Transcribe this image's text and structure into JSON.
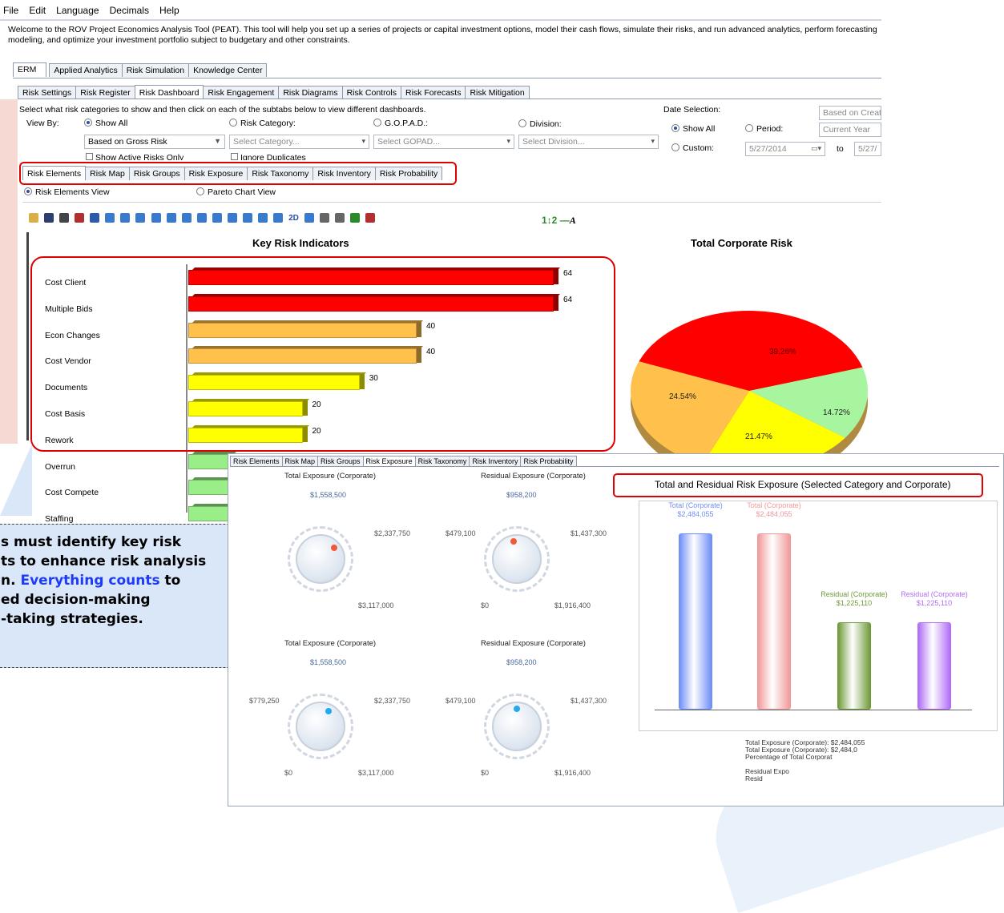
{
  "menu": [
    "File",
    "Edit",
    "Language",
    "Decimals",
    "Help"
  ],
  "welcome_text": "Welcome to the ROV Project Economics Analysis Tool (PEAT). This tool will help you set up a series of projects or capital investment options, model their cash flows, simulate their risks, and run advanced analytics, perform forecasting modeling, and optimize your investment portfolio subject to budgetary and other constraints.",
  "main_tabs": [
    "ERM",
    "Applied Analytics",
    "Risk Simulation",
    "Knowledge Center"
  ],
  "sub_tabs": [
    "Risk Settings",
    "Risk Register",
    "Risk Dashboard",
    "Risk Engagement",
    "Risk Diagrams",
    "Risk Controls",
    "Risk Forecasts",
    "Risk Mitigation"
  ],
  "filters": {
    "instruction": "Select what risk categories to show and then click on each of the subtabs below to view different dashboards.",
    "view_by_label": "View By:",
    "show_all": "Show All",
    "risk_category": "Risk Category:",
    "gopad": "G.O.P.A.D.:",
    "division": "Division:",
    "gross_risk": "Based on Gross Risk",
    "category_placeholder": "Select Category...",
    "gopad_placeholder": "Select GOPAD...",
    "division_placeholder": "Select Division...",
    "active_risks_only": "Show Active Risks Only",
    "ignore_duplicates": "Ignore Duplicates"
  },
  "date_selection": {
    "label": "Date Selection:",
    "show_all": "Show All",
    "period": "Period:",
    "custom": "Custom:",
    "based_on": "Based on Creat",
    "current_year": "Current Year",
    "from": "5/27/2014",
    "to_label": "to",
    "to": "5/27/"
  },
  "dashboard_tabs": [
    "Risk Elements",
    "Risk Map",
    "Risk Groups",
    "Risk Exposure",
    "Risk Taxonomy",
    "Risk Inventory",
    "Risk Probability"
  ],
  "view_options": [
    "Risk Elements View",
    "Pareto Chart View"
  ],
  "chart_data": [
    {
      "type": "bar",
      "title": "Key Risk Indicators",
      "categories": [
        "Cost Client",
        "Multiple Bids",
        "Econ Changes",
        "Cost Vendor",
        "Documents",
        "Cost Basis",
        "Rework",
        "Overrun",
        "Cost Compete",
        "Staffing"
      ],
      "values": [
        64,
        64,
        40,
        40,
        30,
        20,
        20,
        null,
        null,
        null
      ],
      "colors": [
        "#ff0000",
        "#ff0000",
        "#ffc04c",
        "#ffc04c",
        "#ffff00",
        "#ffff00",
        "#ffff00",
        "#99ee88",
        "#99ee88",
        "#99ee88"
      ],
      "xlim": [
        0,
        70
      ]
    },
    {
      "type": "pie",
      "title": "Total Corporate Risk",
      "labels": [
        "39.26%",
        "14.72%",
        "21.47%",
        "24.54%"
      ],
      "values": [
        39.26,
        14.72,
        21.47,
        24.54
      ],
      "colors": [
        "#ff0000",
        "#a8f5a0",
        "#ffff00",
        "#ffc04c"
      ]
    },
    {
      "type": "bar",
      "title": "Total and Residual Risk Exposure (Selected Category and Corporate)",
      "categories": [
        "Total (Corporate)",
        "Total (Corporate)",
        "Residual (Corporate)",
        "Residual (Corporate)"
      ],
      "value_labels": [
        "$2,484,055",
        "$2,484,055",
        "$1,225,110",
        "$1,225,110"
      ],
      "values": [
        2484055,
        2484055,
        1225110,
        1225110
      ],
      "colors": [
        "#6f8ff5",
        "#f09a9a",
        "#6f9a3a",
        "#b06ef5"
      ]
    }
  ],
  "exposure_panel": {
    "tabs": [
      "Risk Elements",
      "Risk Map",
      "Risk Groups",
      "Risk Exposure",
      "Risk Taxonomy",
      "Risk Inventory",
      "Risk Probability"
    ],
    "gauges": [
      {
        "title": "Total Exposure (Corporate)",
        "top": "$1,558,500",
        "left": "",
        "right": "$2,337,750",
        "bottom_left": "",
        "bottom_right": "$3,117,000"
      },
      {
        "title": "Residual Exposure (Corporate)",
        "top": "$958,200",
        "left": "$479,100",
        "right": "$1,437,300",
        "bottom_left": "$0",
        "bottom_right": "$1,916,400"
      },
      {
        "title": "Total Exposure (Corporate)",
        "top": "$1,558,500",
        "left": "$779,250",
        "right": "$2,337,750",
        "bottom_left": "$0",
        "bottom_right": "$3,117,000"
      },
      {
        "title": "Residual Exposure (Corporate)",
        "top": "$958,200",
        "left": "$479,100",
        "right": "$1,437,300",
        "bottom_left": "$0",
        "bottom_right": "$1,916,400"
      }
    ],
    "summary": [
      "Total Exposure (Corporate): $2,484,055",
      "Total Exposure (Corporate): $2,484,0",
      "Percentage of Total Corporat",
      "",
      "Residual Expo",
      "Resid"
    ]
  },
  "note": {
    "line1": "s must identify key risk",
    "line2": "ts to enhance risk analysis",
    "line3a": "n. ",
    "line3b": "Everything counts",
    "line3c": " to",
    "line4": "ed decision-making",
    "line5": "-taking strategies."
  }
}
